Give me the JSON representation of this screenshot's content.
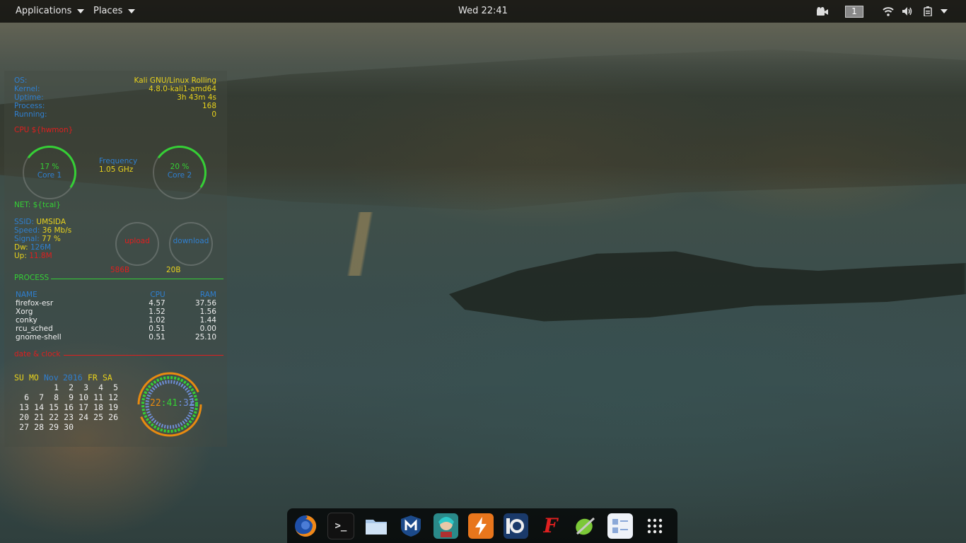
{
  "topbar": {
    "applications_label": "Applications",
    "places_label": "Places",
    "clock": "Wed 22:41",
    "workspace": "1",
    "tray_icons": [
      "camera-icon",
      "wifi-icon",
      "volume-icon",
      "battery-icon",
      "dropdown-icon"
    ]
  },
  "conky": {
    "system": [
      {
        "label": "OS:",
        "value": "Kali GNU/Linux Rolling"
      },
      {
        "label": "Kernel:",
        "value": "4.8.0-kali1-amd64"
      },
      {
        "label": "Uptime:",
        "value": "3h 43m 4s"
      },
      {
        "label": "Process:",
        "value": "168"
      },
      {
        "label": "Running:",
        "value": "0"
      }
    ],
    "cpu_header": "CPU ${hwmon}",
    "core1": {
      "pct": "17 %",
      "label": "Core 1"
    },
    "core2": {
      "pct": "20 %",
      "label": "Core 2"
    },
    "frequency": {
      "label": "Frequency",
      "value": "1.05 GHz"
    },
    "net_header": "NET: ${tcal}",
    "net": [
      {
        "label": "SSID:",
        "value": "UMSIDA"
      },
      {
        "label": "Speed:",
        "value": "36 Mb/s"
      },
      {
        "label": "Signal:",
        "value": "77 %"
      },
      {
        "label": "Dw:",
        "value": "126M"
      },
      {
        "label": "Up:",
        "value": "11.8M"
      }
    ],
    "upload": {
      "label": "upload",
      "value": "586B"
    },
    "download": {
      "label": "download",
      "value": "20B"
    },
    "process_header": "PROCESS",
    "process_columns": [
      "NAME",
      "CPU",
      "RAM"
    ],
    "processes": [
      {
        "name": "firefox-esr",
        "cpu": "4.57",
        "ram": "37.56"
      },
      {
        "name": "Xorg",
        "cpu": "1.52",
        "ram": "1.56"
      },
      {
        "name": "conky",
        "cpu": "1.02",
        "ram": "1.44"
      },
      {
        "name": "rcu_sched",
        "cpu": "0.51",
        "ram": "0.00"
      },
      {
        "name": "gnome-shell",
        "cpu": "0.51",
        "ram": "25.10"
      }
    ],
    "date_header": "date & clock",
    "calendar": {
      "days": [
        "SU",
        "MO",
        "Nov",
        "2016",
        "FR",
        "SA"
      ],
      "weeks": [
        [
          "",
          "",
          "1",
          "2",
          "3",
          "4",
          "5"
        ],
        [
          "6",
          "7",
          "8",
          "9",
          "10",
          "11",
          "12"
        ],
        [
          "13",
          "14",
          "15",
          "16",
          "17",
          "18",
          "19"
        ],
        [
          "20",
          "21",
          "22",
          "23",
          "24",
          "25",
          "26"
        ],
        [
          "27",
          "28",
          "29",
          "30",
          "",
          "",
          ""
        ]
      ]
    },
    "time": {
      "h": "22",
      "m": "41",
      "s": "32"
    }
  },
  "dock": {
    "items": [
      "firefox-icon",
      "terminal-icon",
      "files-icon",
      "metasploit-icon",
      "armitage-icon",
      "burpsuite-icon",
      "maltego-icon",
      "faraday-icon",
      "leafpad-icon",
      "settings-icon",
      "app-grid-icon"
    ]
  }
}
